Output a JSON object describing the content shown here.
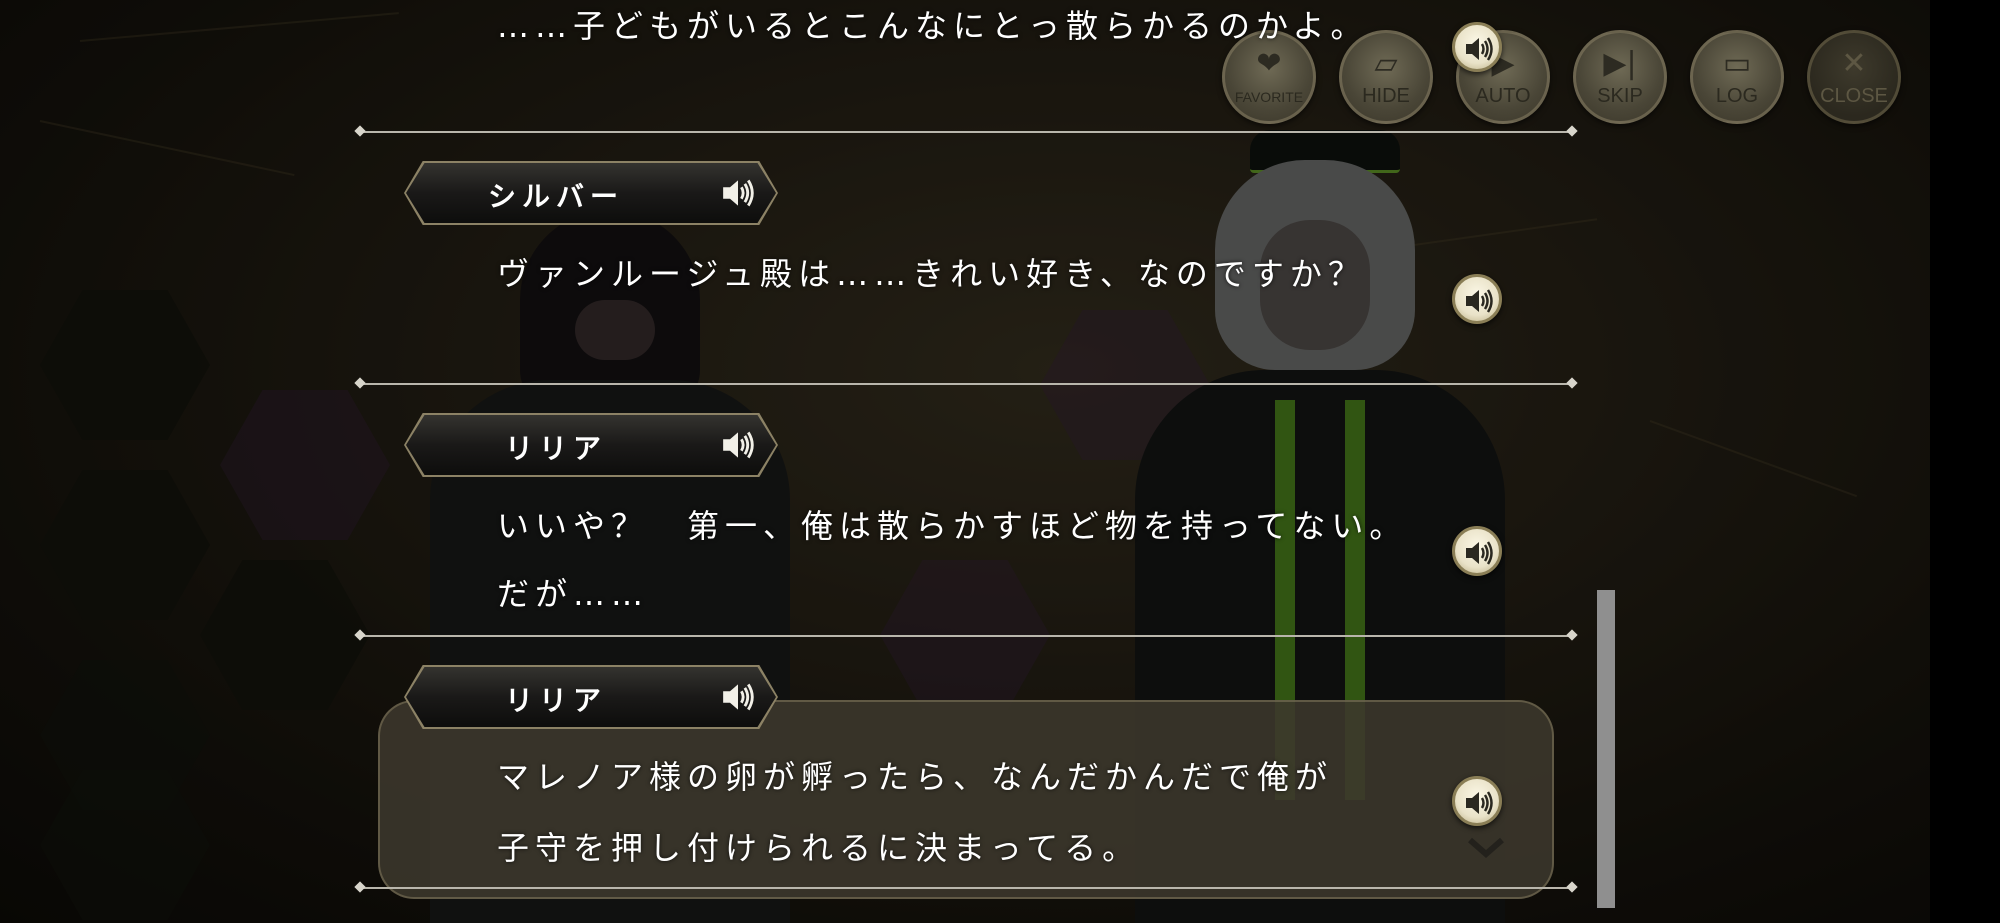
{
  "toolbar": {
    "favorite": "FAVORITE",
    "hide": "HIDE",
    "auto": "AUTO",
    "skip": "SKIP",
    "log": "LOG",
    "close": "CLOSE"
  },
  "log": {
    "top_line": "……子どもがいるとこんなにとっ散らかるのかよ。",
    "entries": [
      {
        "speaker": "シルバー",
        "lines": [
          "ヴァンルージュ殿は……きれい好き、なのですか？"
        ]
      },
      {
        "speaker": "リリア",
        "lines": [
          "いいや？　第一、俺は散らかすほど物を持ってない。",
          "だが……"
        ]
      },
      {
        "speaker": "リリア",
        "lines": [
          "マレノア様の卵が孵ったら、なんだかんだで俺が",
          "子守を押し付けられるに決まってる。"
        ]
      }
    ]
  },
  "icons": {
    "voice": "speaker-icon",
    "favorite": "heart-icon",
    "hide": "hide-icon",
    "auto": "auto-icon",
    "skip": "skip-icon",
    "log": "log-icon",
    "close": "close-icon"
  },
  "colors": {
    "nameplate_border": "#8c8265",
    "voice_button": "#e9e2c8",
    "text": "#ffffff"
  }
}
